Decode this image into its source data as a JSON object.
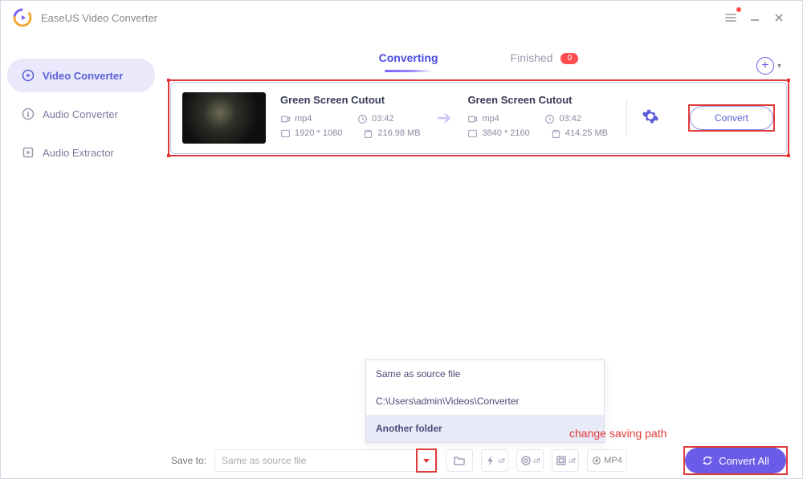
{
  "app": {
    "title": "EaseUS Video Converter"
  },
  "sidebar": {
    "items": [
      {
        "label": "Video Converter"
      },
      {
        "label": "Audio Converter"
      },
      {
        "label": "Audio Extractor"
      }
    ]
  },
  "tabs": {
    "converting": "Converting",
    "finished": "Finished",
    "finished_count": "0"
  },
  "item": {
    "source": {
      "title": "Green Screen Cutout",
      "format": "mp4",
      "duration": "03:42",
      "resolution": "1920 * 1080",
      "size": "216.98 MB"
    },
    "target": {
      "title": "Green Screen Cutout",
      "format": "mp4",
      "duration": "03:42",
      "resolution": "3840 * 2160",
      "size": "414.25 MB"
    },
    "convert_label": "Convert"
  },
  "footer": {
    "save_to_label": "Save to:",
    "path_display": "Same as source file",
    "format_label": "MP4",
    "convert_all": "Convert All"
  },
  "dropdown": {
    "opt1": "Same as source file",
    "opt2": "C:\\Users\\admin\\Videos\\Converter",
    "opt3": "Another folder"
  },
  "annotation": {
    "saving_path": "change saving path"
  },
  "toggles": {
    "off": "off"
  }
}
